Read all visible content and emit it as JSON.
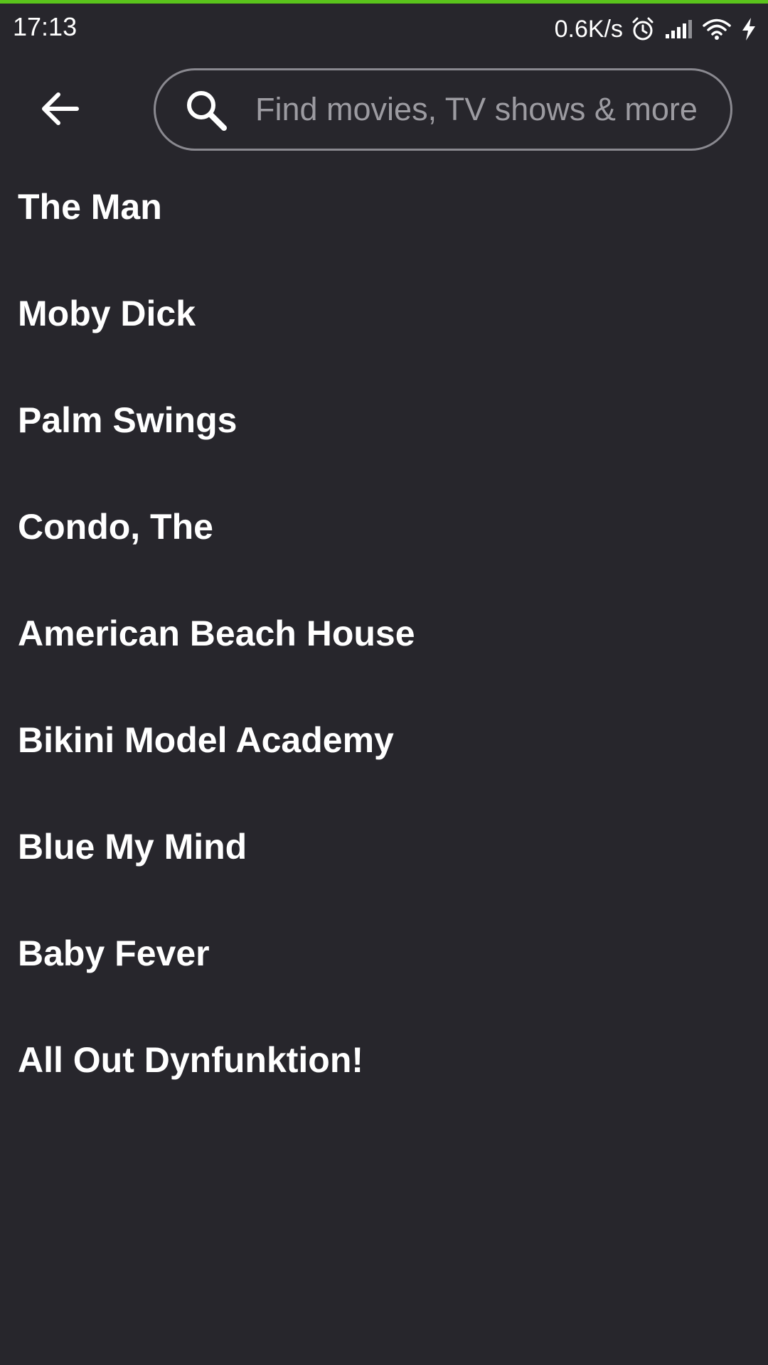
{
  "status_bar": {
    "time": "17:13",
    "net_speed": "0.6K/s",
    "icons": [
      "alarm-icon",
      "signal-icon",
      "wifi-icon",
      "charging-icon"
    ]
  },
  "header": {
    "back_icon": "arrow-left-icon",
    "search": {
      "icon": "search-icon",
      "placeholder": "Find movies, TV shows & more",
      "value": ""
    }
  },
  "results": [
    {
      "title": "The Man"
    },
    {
      "title": "Moby Dick"
    },
    {
      "title": "Palm Swings"
    },
    {
      "title": "Condo, The"
    },
    {
      "title": "American Beach House"
    },
    {
      "title": "Bikini Model Academy"
    },
    {
      "title": "Blue My Mind"
    },
    {
      "title": "Baby Fever"
    },
    {
      "title": "All Out Dynfunktion!"
    }
  ],
  "colors": {
    "background": "#27262c",
    "accent": "#5ac31c",
    "text": "#ffffff",
    "placeholder": "#9c9ba1",
    "search_border": "#8a8990"
  }
}
